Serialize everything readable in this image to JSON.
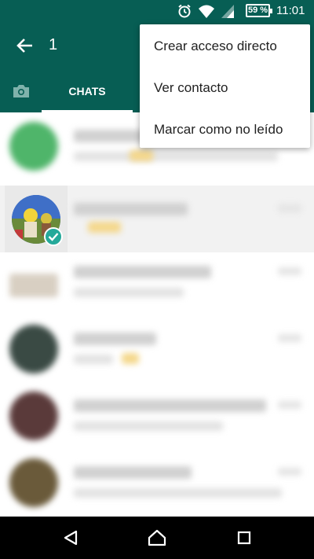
{
  "status_bar": {
    "battery": "59 %",
    "time": "11:01",
    "icons": [
      "alarm-icon",
      "wifi-icon",
      "signal-icon",
      "battery-icon"
    ]
  },
  "app_bar": {
    "selected_count": "1"
  },
  "tabs": {
    "camera_icon": "camera-icon",
    "chats_label": "CHATS"
  },
  "menu": {
    "items": [
      {
        "label": "Crear acceso directo"
      },
      {
        "label": "Ver contacto"
      },
      {
        "label": "Marcar como no leído"
      }
    ]
  },
  "nav_bar": {
    "icons": [
      "back-triangle-icon",
      "home-icon",
      "recents-icon"
    ]
  },
  "colors": {
    "primary": "#075e54",
    "accent": "#25a99a"
  }
}
